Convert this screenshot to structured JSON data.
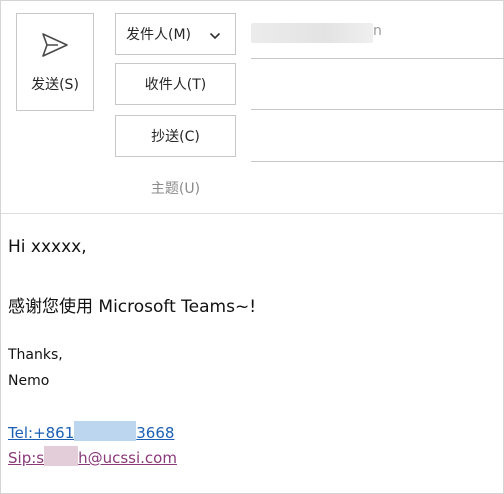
{
  "compose": {
    "send_label": "发送(S)",
    "from_label": "发件人(M)",
    "from_value_tail": "n",
    "to_label": "收件人(T)",
    "cc_label": "抄送(C)",
    "subject_label": "主题(U)"
  },
  "message": {
    "greeting": "Hi xxxxx,",
    "thanks_cn": "感谢您使用 Microsoft Teams~!",
    "sign_thanks": "Thanks,",
    "sign_name": "Nemo",
    "tel_prefix": "Tel:+861",
    "tel_suffix": "3668",
    "sip_prefix": "Sip:s",
    "sip_suffix": "h@ucssi.com"
  },
  "icons": {
    "send": "send-icon",
    "from_dropdown": "chevron-down-icon"
  },
  "colors": {
    "link_tel": "#1a5fb4",
    "link_sip": "#8a3a7a",
    "border": "#c8c8c8"
  }
}
